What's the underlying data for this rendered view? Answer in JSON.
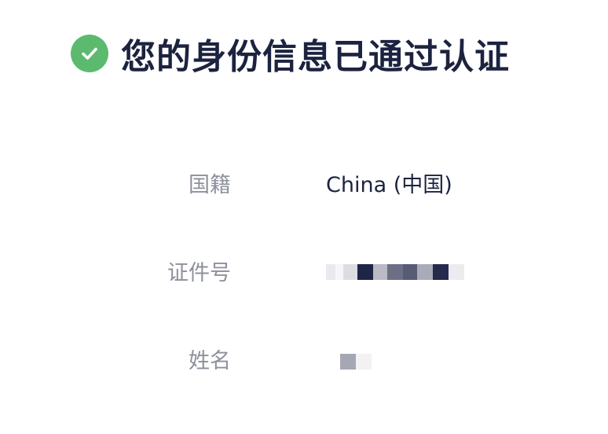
{
  "header": {
    "title": "您的身份信息已通过认证",
    "status_icon": "check-circle-icon",
    "accent_color": "#5cba6e"
  },
  "fields": [
    {
      "label": "国籍",
      "value": "China (中国)"
    },
    {
      "label": "证件号",
      "value_state": "pixelated"
    },
    {
      "label": "姓名",
      "value_state": "pixelated"
    }
  ]
}
